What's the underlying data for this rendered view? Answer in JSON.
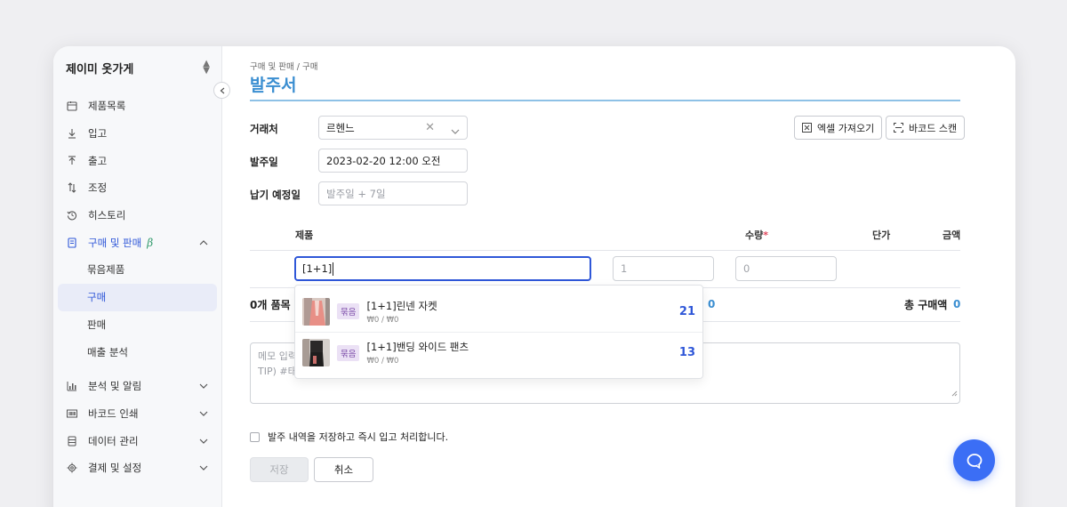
{
  "sidebar": {
    "store_name": "제이미 옷가게",
    "items": [
      {
        "label": "제품목록",
        "icon": "product-list-icon"
      },
      {
        "label": "입고",
        "icon": "download-icon"
      },
      {
        "label": "출고",
        "icon": "upload-icon"
      },
      {
        "label": "조정",
        "icon": "swap-icon"
      },
      {
        "label": "히스토리",
        "icon": "history-icon"
      }
    ],
    "group_trade": {
      "label": "구매 및 판매",
      "beta": "β",
      "subitems": [
        {
          "label": "묶음제품"
        },
        {
          "label": "구매"
        },
        {
          "label": "판매"
        },
        {
          "label": "매출 분석"
        }
      ]
    },
    "bottom_groups": [
      {
        "label": "분석 및 알림",
        "icon": "bar-chart-icon"
      },
      {
        "label": "바코드 인쇄",
        "icon": "barcode-icon"
      },
      {
        "label": "데이터 관리",
        "icon": "database-icon"
      },
      {
        "label": "결제 및 설정",
        "icon": "gear-icon"
      }
    ]
  },
  "breadcrumb": "구매 및 판매 / 구매",
  "page_title": "발주서",
  "form": {
    "vendor_label": "거래처",
    "vendor_value": "르헨느",
    "order_date_label": "발주일",
    "order_date_value": "2023-02-20 12:00 오전",
    "due_date_label": "납기 예정일",
    "due_date_placeholder": "발주일 + 7일"
  },
  "toolbar": {
    "excel_label": "엑셀 가져오기",
    "barcode_label": "바코드 스캔"
  },
  "table": {
    "col_product": "제품",
    "col_qty": "수량",
    "col_qty_required": "*",
    "col_unit_price": "단가",
    "col_amount": "금액",
    "product_input_value": "[1+1]",
    "qty_placeholder": "1",
    "unit_price_placeholder": "0"
  },
  "summary": {
    "items_count": "0개 품목",
    "qty_total": "0",
    "total_label": "총 구매액",
    "total_value": "0"
  },
  "memo": {
    "line1": "메모 입력",
    "line2": "TIP) #태그"
  },
  "checkbox_label": "발주 내역을 저장하고 즉시 입고 처리합니다.",
  "buttons": {
    "save": "저장",
    "cancel": "취소"
  },
  "dropdown": {
    "options": [
      {
        "tag": "묶음",
        "name": "[1+1]린넨 자켓",
        "price": "₩0 / ₩0",
        "qty": "21"
      },
      {
        "tag": "묶음",
        "name": "[1+1]밴딩 와이드 팬츠",
        "price": "₩0 / ₩0",
        "qty": "13"
      }
    ]
  },
  "colors": {
    "accent": "#2f57d8",
    "title": "#3a8ed1",
    "chat_button": "#3b6ef5"
  }
}
